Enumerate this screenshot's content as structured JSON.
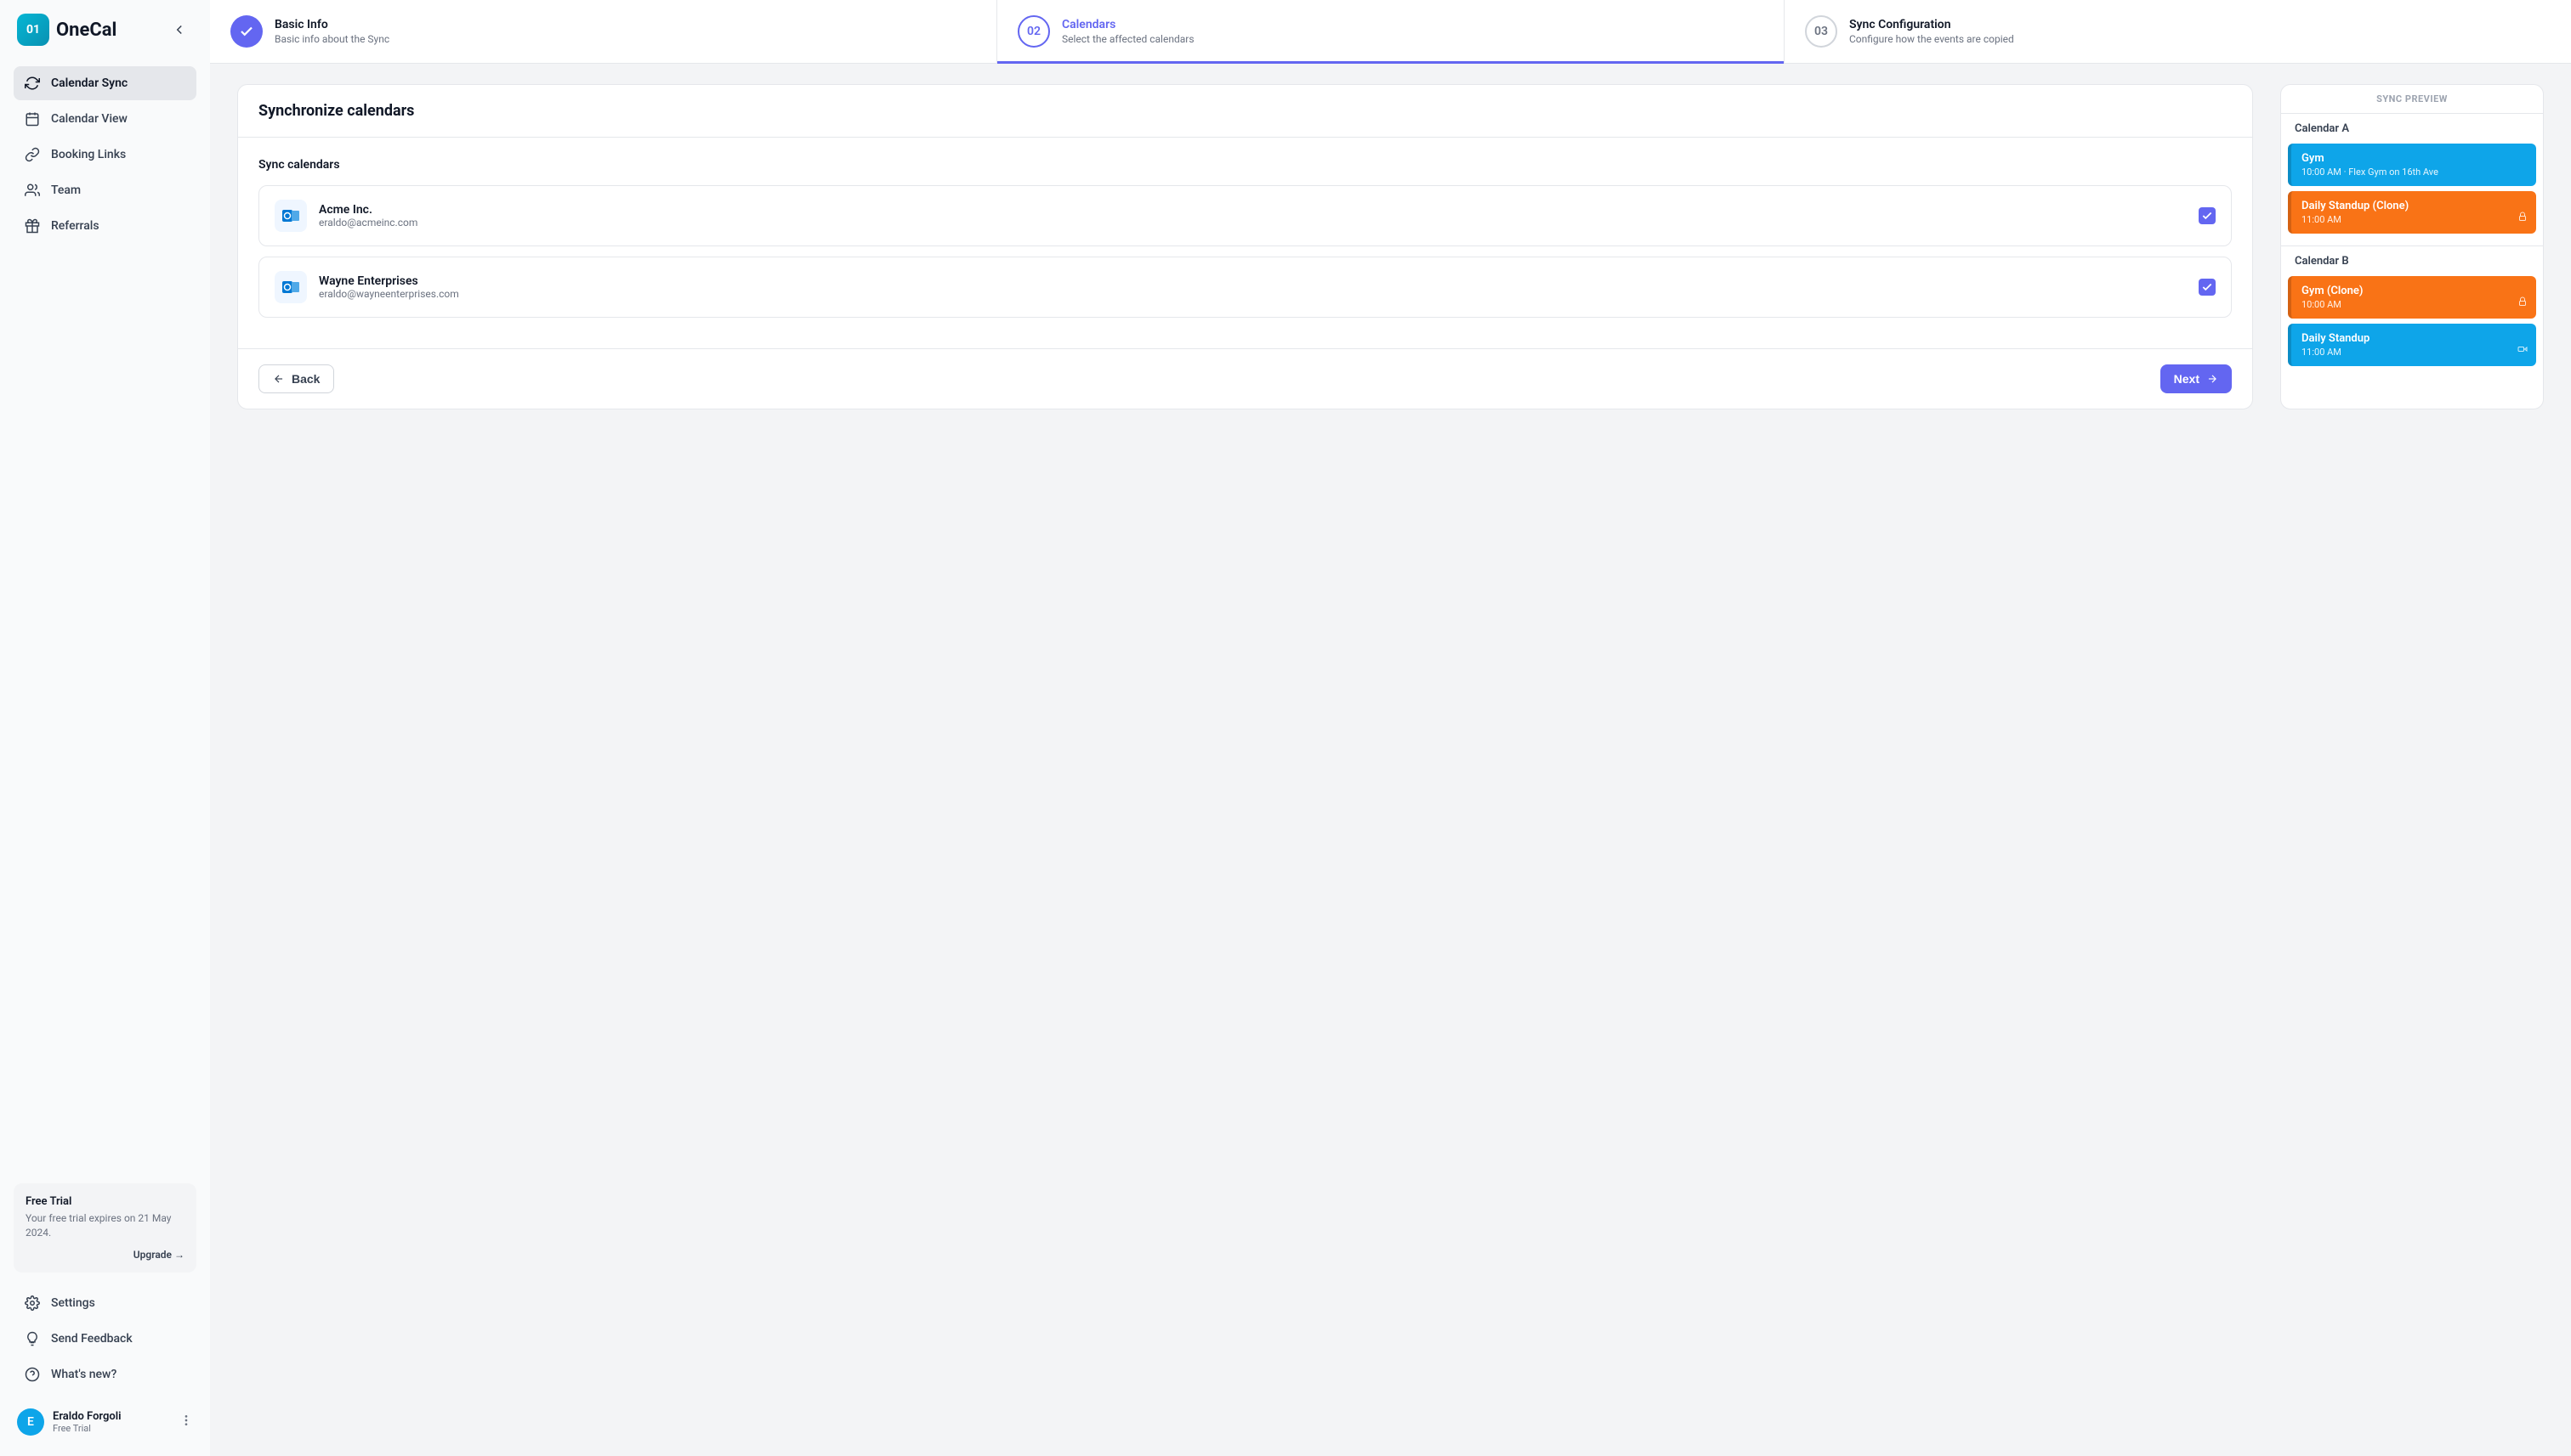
{
  "brand": {
    "badge": "01",
    "name": "OneCal"
  },
  "sidebar": {
    "items": [
      {
        "label": "Calendar Sync"
      },
      {
        "label": "Calendar View"
      },
      {
        "label": "Booking Links"
      },
      {
        "label": "Team"
      },
      {
        "label": "Referrals"
      }
    ],
    "trial": {
      "title": "Free Trial",
      "desc": "Your free trial expires on 21 May 2024.",
      "upgrade": "Upgrade →"
    },
    "bottom": [
      {
        "label": "Settings"
      },
      {
        "label": "Send Feedback"
      },
      {
        "label": "What's new?"
      }
    ],
    "user": {
      "initial": "E",
      "name": "Eraldo Forgoli",
      "plan": "Free Trial"
    }
  },
  "stepper": [
    {
      "num": "✓",
      "title": "Basic Info",
      "desc": "Basic info about the Sync"
    },
    {
      "num": "02",
      "title": "Calendars",
      "desc": "Select the affected calendars"
    },
    {
      "num": "03",
      "title": "Sync Configuration",
      "desc": "Configure how the events are copied"
    }
  ],
  "panel": {
    "title": "Synchronize calendars",
    "section_label": "Sync calendars",
    "calendars": [
      {
        "name": "Acme Inc.",
        "email": "eraldo@acmeinc.com"
      },
      {
        "name": "Wayne Enterprises",
        "email": "eraldo@wayneenterprises.com"
      }
    ],
    "back": "Back",
    "next": "Next"
  },
  "preview": {
    "header": "SYNC PREVIEW",
    "sections": [
      {
        "label": "Calendar A",
        "events": [
          {
            "title": "Gym",
            "time": "10:00 AM · Flex Gym on 16th Ave",
            "color": "sky",
            "icon": ""
          },
          {
            "title": "Daily Standup (Clone)",
            "time": "11:00 AM",
            "color": "orange",
            "icon": "lock"
          }
        ]
      },
      {
        "label": "Calendar B",
        "events": [
          {
            "title": "Gym (Clone)",
            "time": "10:00 AM",
            "color": "orange",
            "icon": "lock"
          },
          {
            "title": "Daily Standup",
            "time": "11:00 AM",
            "color": "sky",
            "icon": "video"
          }
        ]
      }
    ]
  }
}
